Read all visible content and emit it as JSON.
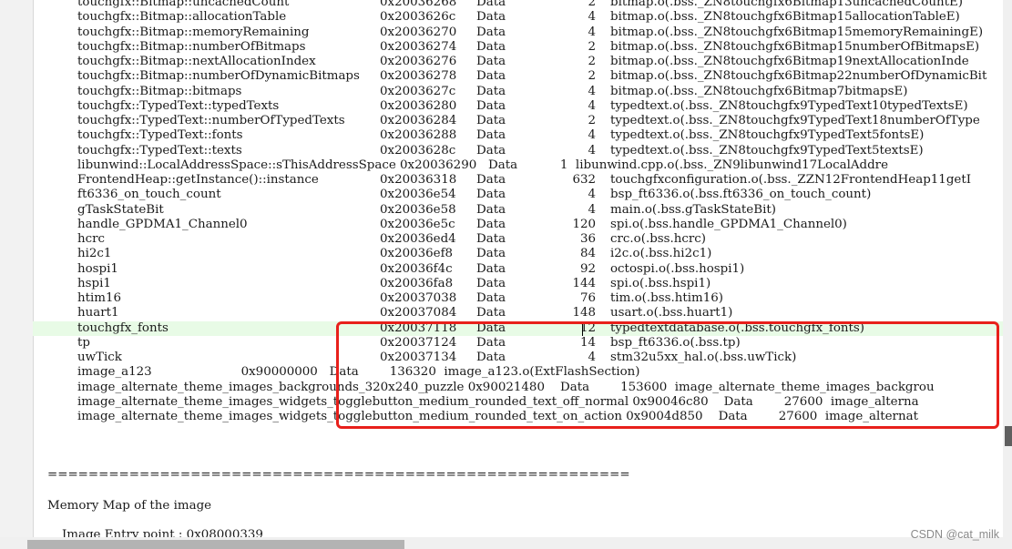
{
  "symbol_rows": [
    {
      "name": "touchgfx::Bitmap::uncachedCount",
      "address": "0x20036268",
      "type": "Data",
      "size": "2",
      "object": "bitmap.o(.bss._ZN8touchgfx6Bitmap13uncachedCountE)"
    },
    {
      "name": "touchgfx::Bitmap::allocationTable",
      "address": "0x2003626c",
      "type": "Data",
      "size": "4",
      "object": "bitmap.o(.bss._ZN8touchgfx6Bitmap15allocationTableE)"
    },
    {
      "name": "touchgfx::Bitmap::memoryRemaining",
      "address": "0x20036270",
      "type": "Data",
      "size": "4",
      "object": "bitmap.o(.bss._ZN8touchgfx6Bitmap15memoryRemainingE)"
    },
    {
      "name": "touchgfx::Bitmap::numberOfBitmaps",
      "address": "0x20036274",
      "type": "Data",
      "size": "2",
      "object": "bitmap.o(.bss._ZN8touchgfx6Bitmap15numberOfBitmapsE)"
    },
    {
      "name": "touchgfx::Bitmap::nextAllocationIndex",
      "address": "0x20036276",
      "type": "Data",
      "size": "2",
      "object": "bitmap.o(.bss._ZN8touchgfx6Bitmap19nextAllocationInde"
    },
    {
      "name": "touchgfx::Bitmap::numberOfDynamicBitmaps",
      "address": "0x20036278",
      "type": "Data",
      "size": "2",
      "object": "bitmap.o(.bss._ZN8touchgfx6Bitmap22numberOfDynamicBit"
    },
    {
      "name": "touchgfx::Bitmap::bitmaps",
      "address": "0x2003627c",
      "type": "Data",
      "size": "4",
      "object": "bitmap.o(.bss._ZN8touchgfx6Bitmap7bitmapsE)"
    },
    {
      "name": "touchgfx::TypedText::typedTexts",
      "address": "0x20036280",
      "type": "Data",
      "size": "4",
      "object": "typedtext.o(.bss._ZN8touchgfx9TypedText10typedTextsE)"
    },
    {
      "name": "touchgfx::TypedText::numberOfTypedTexts",
      "address": "0x20036284",
      "type": "Data",
      "size": "2",
      "object": "typedtext.o(.bss._ZN8touchgfx9TypedText18numberOfType"
    },
    {
      "name": "touchgfx::TypedText::fonts",
      "address": "0x20036288",
      "type": "Data",
      "size": "4",
      "object": "typedtext.o(.bss._ZN8touchgfx9TypedText5fontsE)"
    },
    {
      "name": "touchgfx::TypedText::texts",
      "address": "0x2003628c",
      "type": "Data",
      "size": "4",
      "object": "typedtext.o(.bss._ZN8touchgfx9TypedText5textsE)"
    }
  ],
  "overflow_row_1": "libunwind::LocalAddressSpace::sThisAddressSpace 0x20036290   Data           1  libunwind.cpp.o(.bss._ZN9libunwind17LocalAddre",
  "symbol_rows_2": [
    {
      "name": "FrontendHeap::getInstance()::instance",
      "address": "0x20036318",
      "type": "Data",
      "size": "632",
      "object": "touchgfxconfiguration.o(.bss._ZZN12FrontendHeap11getI"
    },
    {
      "name": "ft6336_on_touch_count",
      "address": "0x20036e54",
      "type": "Data",
      "size": "4",
      "object": "bsp_ft6336.o(.bss.ft6336_on_touch_count)"
    },
    {
      "name": "gTaskStateBit",
      "address": "0x20036e58",
      "type": "Data",
      "size": "4",
      "object": "main.o(.bss.gTaskStateBit)"
    },
    {
      "name": "handle_GPDMA1_Channel0",
      "address": "0x20036e5c",
      "type": "Data",
      "size": "120",
      "object": "spi.o(.bss.handle_GPDMA1_Channel0)"
    },
    {
      "name": "hcrc",
      "address": "0x20036ed4",
      "type": "Data",
      "size": "36",
      "object": "crc.o(.bss.hcrc)"
    },
    {
      "name": "hi2c1",
      "address": "0x20036ef8",
      "type": "Data",
      "size": "84",
      "object": "i2c.o(.bss.hi2c1)"
    },
    {
      "name": "hospi1",
      "address": "0x20036f4c",
      "type": "Data",
      "size": "92",
      "object": "octospi.o(.bss.hospi1)"
    },
    {
      "name": "hspi1",
      "address": "0x20036fa8",
      "type": "Data",
      "size": "144",
      "object": "spi.o(.bss.hspi1)"
    },
    {
      "name": "htim16",
      "address": "0x20037038",
      "type": "Data",
      "size": "76",
      "object": "tim.o(.bss.htim16)"
    },
    {
      "name": "huart1",
      "address": "0x20037084",
      "type": "Data",
      "size": "148",
      "object": "usart.o(.bss.huart1)"
    },
    {
      "name": "touchgfx_fonts",
      "address": "0x20037118",
      "type": "Data",
      "size": "12",
      "object": "typedtextdatabase.o(.bss.touchgfx_fonts)"
    },
    {
      "name": "tp",
      "address": "0x20037124",
      "type": "Data",
      "size": "14",
      "object": "bsp_ft6336.o(.bss.tp)"
    },
    {
      "name": "uwTick",
      "address": "0x20037134",
      "type": "Data",
      "size": "4",
      "object": "stm32u5xx_hal.o(.bss.uwTick)"
    }
  ],
  "overflow_rows_2": [
    "image_a123                       0x90000000   Data        136320  image_a123.o(ExtFlashSection)",
    "image_alternate_theme_images_backgrounds_320x240_puzzle 0x90021480    Data        153600  image_alternate_theme_images_backgrou",
    "image_alternate_theme_images_widgets_togglebutton_medium_rounded_text_off_normal 0x90046c80    Data        27600  image_alterna",
    "image_alternate_theme_images_widgets_togglebutton_medium_rounded_text_on_action 0x9004d850    Data        27600  image_alternat"
  ],
  "separator": "==============================================================================",
  "section_heading": "Memory Map of the image",
  "entry_point_line": "Image Entry point : 0x08000339",
  "watermark": "CSDN @cat_milk",
  "highlighted_row_index": 22,
  "colors": {
    "highlight_row": "#e8fbe6",
    "annotation_box": "#e8201b"
  }
}
